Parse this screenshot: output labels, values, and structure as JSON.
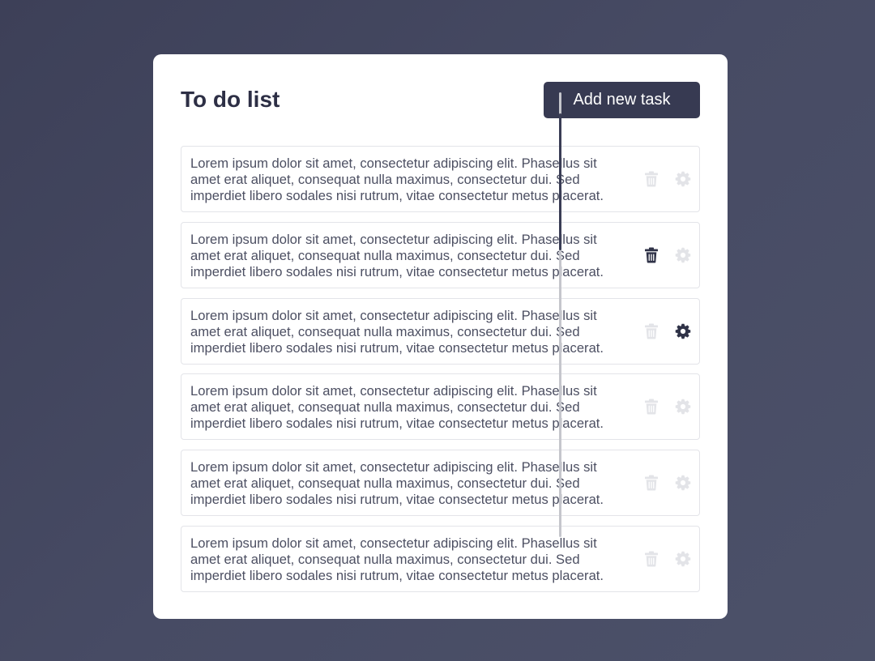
{
  "card": {
    "title": "To do list",
    "add_button_label": "Add new task"
  },
  "tasks": [
    {
      "text": "Lorem ipsum dolor sit amet, consectetur adipiscing elit. Phasellus sit amet erat aliquet, consequat nulla maximus, consectetur dui. Sed imperdiet libero sodales nisi rutrum, vitae consectetur metus placerat.",
      "trash_state": "inactive",
      "gear_state": "inactive"
    },
    {
      "text": "Lorem ipsum dolor sit amet, consectetur adipiscing elit. Phasellus sit amet erat aliquet, consequat nulla maximus, consectetur dui. Sed imperdiet libero sodales nisi rutrum, vitae consectetur metus placerat.",
      "trash_state": "active",
      "gear_state": "inactive"
    },
    {
      "text": "Lorem ipsum dolor sit amet, consectetur adipiscing elit. Phasellus sit amet erat aliquet, consequat nulla maximus, consectetur dui. Sed imperdiet libero sodales nisi rutrum, vitae consectetur metus placerat.",
      "trash_state": "inactive",
      "gear_state": "active"
    },
    {
      "text": "Lorem ipsum dolor sit amet, consectetur adipiscing elit. Phasellus sit amet erat aliquet, consequat nulla maximus, consectetur dui. Sed imperdiet libero sodales nisi rutrum, vitae consectetur metus placerat.",
      "trash_state": "inactive",
      "gear_state": "inactive"
    },
    {
      "text": "Lorem ipsum dolor sit amet, consectetur adipiscing elit. Phasellus sit amet erat aliquet, consequat nulla maximus, consectetur dui. Sed imperdiet libero sodales nisi rutrum, vitae consectetur metus placerat.",
      "trash_state": "inactive",
      "gear_state": "inactive"
    },
    {
      "text": "Lorem ipsum dolor sit amet, consectetur adipiscing elit. Phasellus sit amet erat aliquet, consequat nulla maximus, consectetur dui. Sed imperdiet libero sodales nisi rutrum, vitae consectetur metus placerat.",
      "trash_state": "inactive",
      "gear_state": "inactive"
    }
  ],
  "icons": {
    "trash": "trash-icon",
    "gear": "gear-icon"
  },
  "colors": {
    "icon_active": "#2f3247",
    "icon_inactive": "#e3e4e8",
    "button_bg": "#373a52",
    "title": "#2d2f45",
    "task_text": "#4c4f62",
    "task_border": "#e3e4e9"
  },
  "scrollbar": {
    "visible": true
  }
}
